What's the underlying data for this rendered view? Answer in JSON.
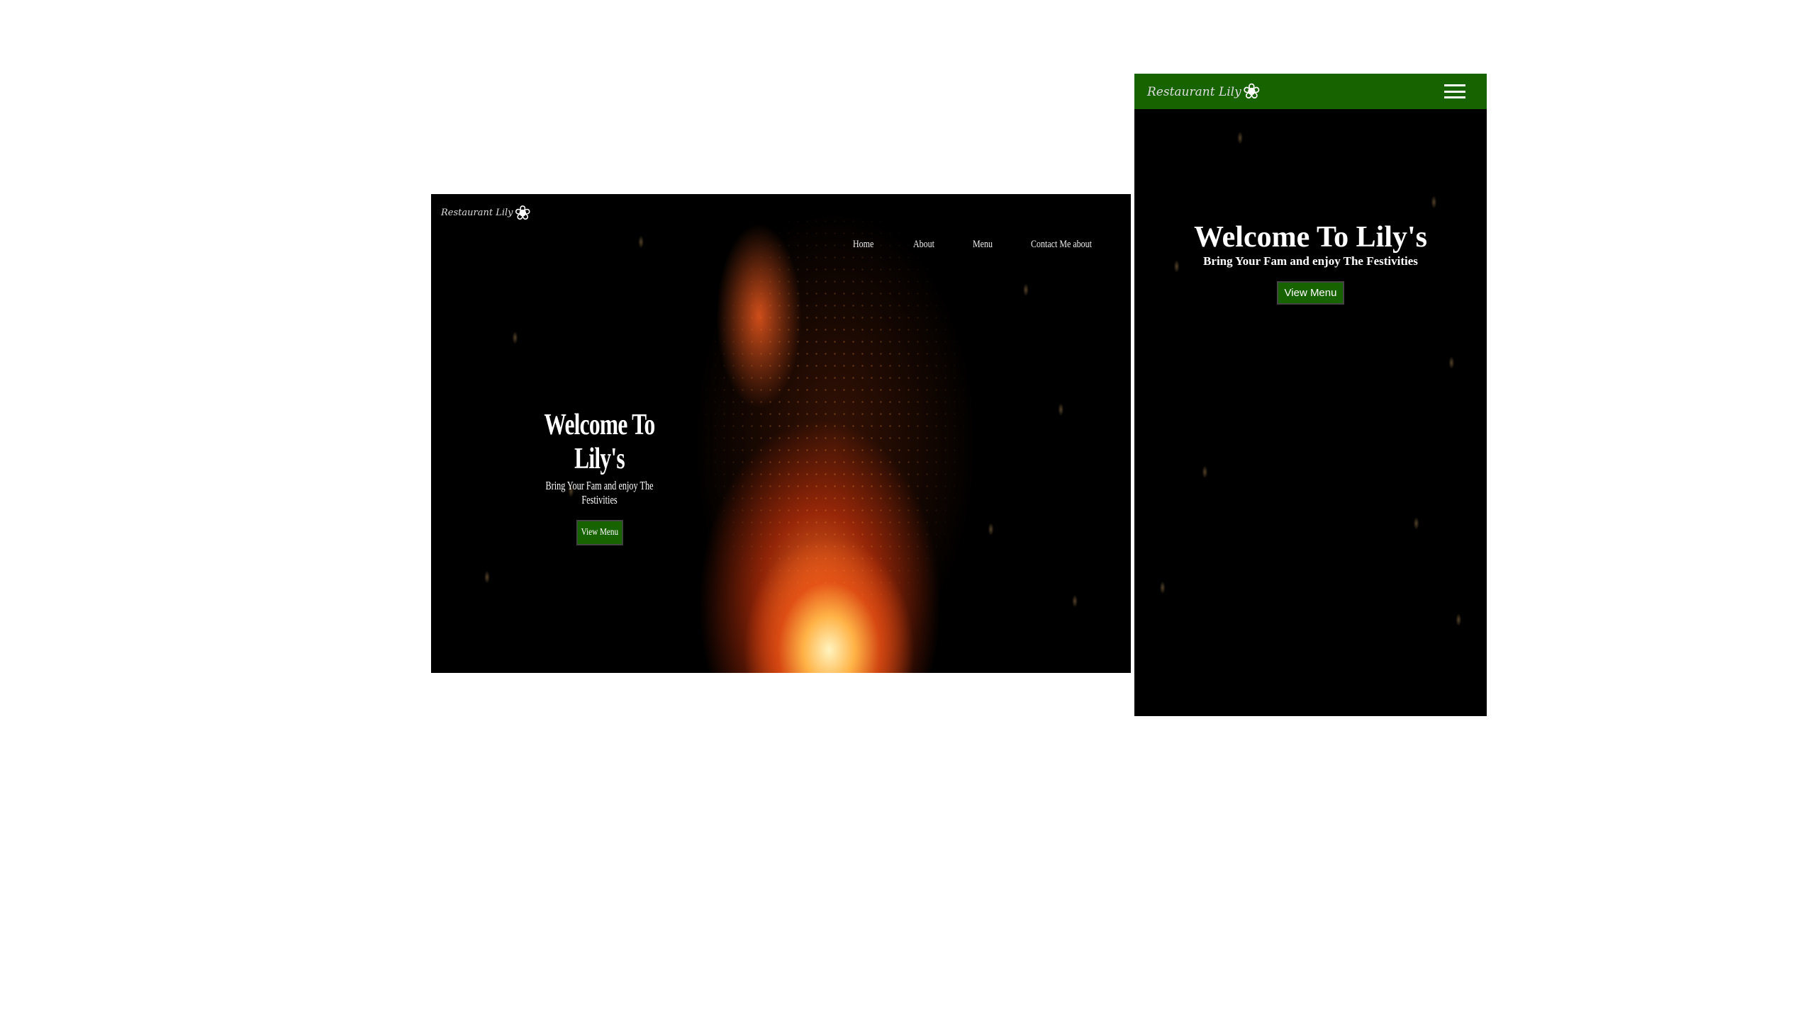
{
  "brand": {
    "name": "Restaurant Lily",
    "logo_icon": "lotus-icon",
    "accent_color": "#176300"
  },
  "desktop": {
    "nav": [
      {
        "label": "Home"
      },
      {
        "label": "About"
      },
      {
        "label": "Menu"
      },
      {
        "label": "Contact Me about"
      }
    ],
    "hero": {
      "title": "Welcome To Lily's",
      "subtitle": "Bring Your Fam and enjoy The Festivities",
      "button": "View Menu"
    }
  },
  "mobile": {
    "menu_icon": "hamburger-icon",
    "hero": {
      "title": "Welcome To Lily's",
      "subtitle": "Bring Your Fam and enjoy The Festivities",
      "button": "View Menu"
    }
  }
}
